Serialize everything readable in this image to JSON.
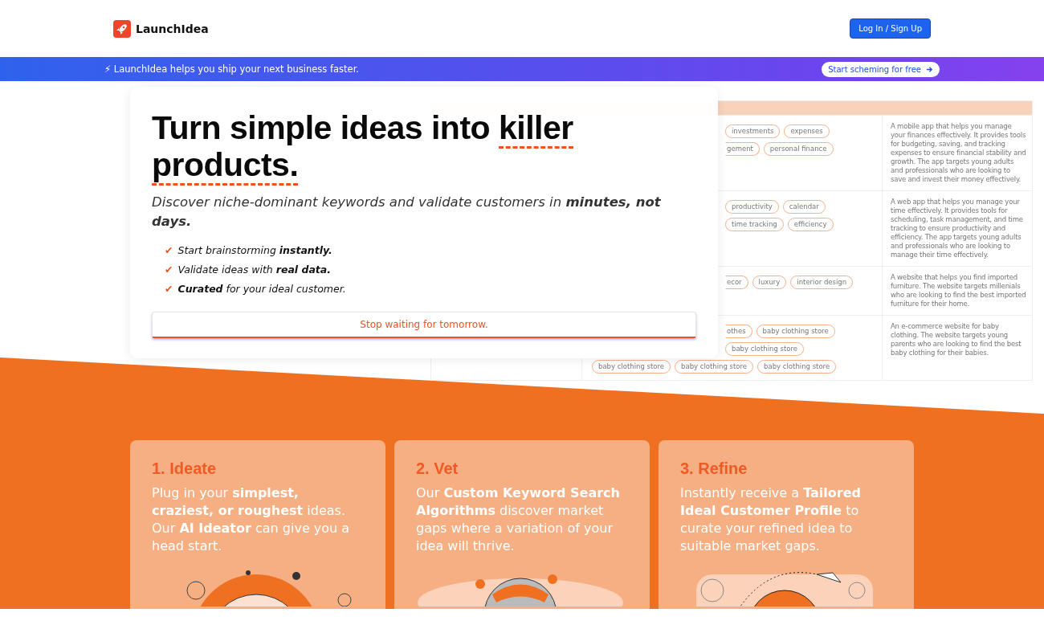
{
  "header": {
    "brand": "LaunchIdea",
    "login_button": "Log In / Sign Up"
  },
  "banner": {
    "icon": "⚡",
    "text": "LaunchIdea helps you ship your next business faster.",
    "cta": "Start scheming for free"
  },
  "hero": {
    "title": [
      {
        "text": "Turn simple ideas into",
        "underline": false
      },
      {
        "text": "killer",
        "underline": true
      },
      {
        "text": "products.",
        "underline": true
      }
    ],
    "subtitle": "Discover niche-dominant keywords and validate customers in **minutes, not days.**",
    "checks": [
      {
        "icon": "✔",
        "text": "Start brainstorming **instantly.**"
      },
      {
        "icon": "✔",
        "text": "Validate ideas with **real data.**"
      },
      {
        "icon": "✔",
        "text": "**Curated** for your ideal customer."
      }
    ],
    "button": "Stop waiting for tomorrow."
  },
  "preview_table": {
    "rows": [
      {
        "tags": [
          {
            "text": "investments",
            "partial": false
          },
          {
            "text": "expenses",
            "partial": false
          },
          {
            "text": "gement",
            "partial": true
          },
          {
            "text": "personal finance",
            "partial": false
          }
        ],
        "description": "A mobile app that helps you manage your finances effectively. It provides tools for budgeting, saving, and tracking expenses to ensure financial stability and growth. The app targets young adults and professionals who are looking to save and invest their money effectively."
      },
      {
        "tags": [
          {
            "text": "productivity",
            "partial": false
          },
          {
            "text": "calendar",
            "partial": false
          },
          {
            "text": "time tracking",
            "partial": false
          },
          {
            "text": "efficiency",
            "partial": false
          }
        ],
        "description": "A web app that helps you manage your time effectively. It provides tools for scheduling, task management, and time tracking to ensure productivity and efficiency. The app targets young adults and professionals who are looking to manage their time effectively."
      },
      {
        "tags": [
          {
            "text": "ecor",
            "partial": true
          },
          {
            "text": "luxury",
            "partial": false
          },
          {
            "text": "interior design",
            "partial": false
          }
        ],
        "description": "A website that helps you find imported furniture. The website targets millenials who are looking to find the best imported furniture for their home."
      },
      {
        "tags": [
          {
            "text": "othes",
            "partial": true
          },
          {
            "text": "baby clothing store",
            "partial": false
          },
          {
            "text": "baby clothing store",
            "partial": false
          },
          {
            "text": "baby clothing store",
            "partial": false
          },
          {
            "text": "baby clothing store",
            "partial": false
          },
          {
            "text": "baby clothing store",
            "partial": false
          }
        ],
        "description": "An e-commerce website for baby clothing. The website targets young parents who are looking to find the best baby clothing for their babies."
      }
    ]
  },
  "features": [
    {
      "kind": "ideate",
      "title": "1. Ideate",
      "text": "Plug in your **simplest, craziest, or roughest** ideas. Our **AI Ideator** can give you a head start."
    },
    {
      "kind": "vet",
      "title": "2. Vet",
      "text": "Our **Custom Keyword Search Algorithms** discover market gaps where a variation of your idea will thrive."
    },
    {
      "kind": "refine",
      "title": "3. Refine",
      "text": "Instantly receive a **Tailored Ideal Customer Profile** to curate your refined idea to suitable market gaps."
    }
  ]
}
